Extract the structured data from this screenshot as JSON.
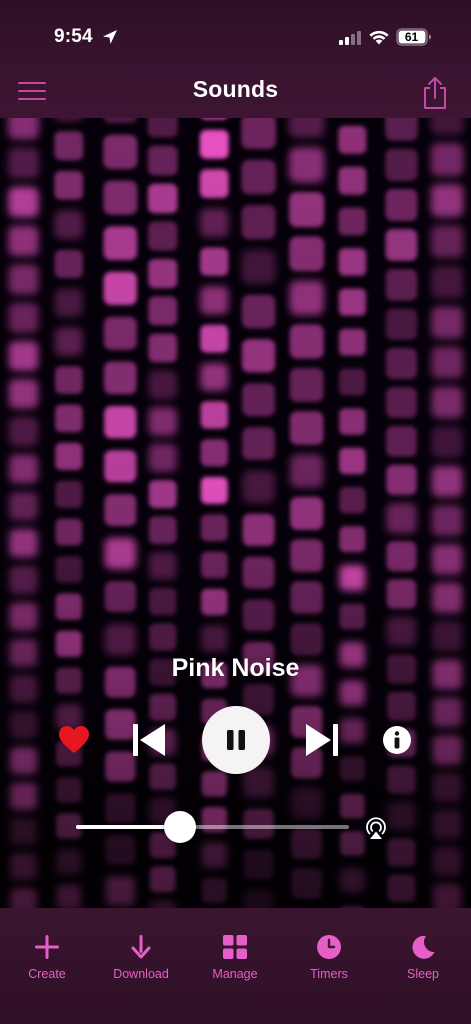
{
  "status_bar": {
    "time": "9:54",
    "battery_level": "61",
    "icons": [
      "location-arrow-icon",
      "cellular-signal-icon",
      "wifi-icon",
      "battery-icon"
    ]
  },
  "nav": {
    "title": "Sounds",
    "left_icon": "hamburger-menu-icon",
    "right_icon": "share-icon"
  },
  "player": {
    "track_title": "Pink Noise",
    "is_favorite": true,
    "state": "playing",
    "volume_fraction": 0.38,
    "icons": [
      "heart-icon",
      "skip-previous-icon",
      "pause-icon",
      "skip-next-icon",
      "info-icon",
      "airplay-icon"
    ]
  },
  "tab_bar": {
    "items": [
      {
        "label": "Create",
        "icon": "plus-icon"
      },
      {
        "label": "Download",
        "icon": "download-arrow-icon"
      },
      {
        "label": "Manage",
        "icon": "grid-icon"
      },
      {
        "label": "Timers",
        "icon": "clock-icon"
      },
      {
        "label": "Sleep",
        "icon": "moon-icon"
      }
    ]
  },
  "colors": {
    "accent": "#e65fc8",
    "header_bg": "#3a1430",
    "visualizer_pink": "#ff5ad6",
    "favorite_red": "#e8161e"
  }
}
